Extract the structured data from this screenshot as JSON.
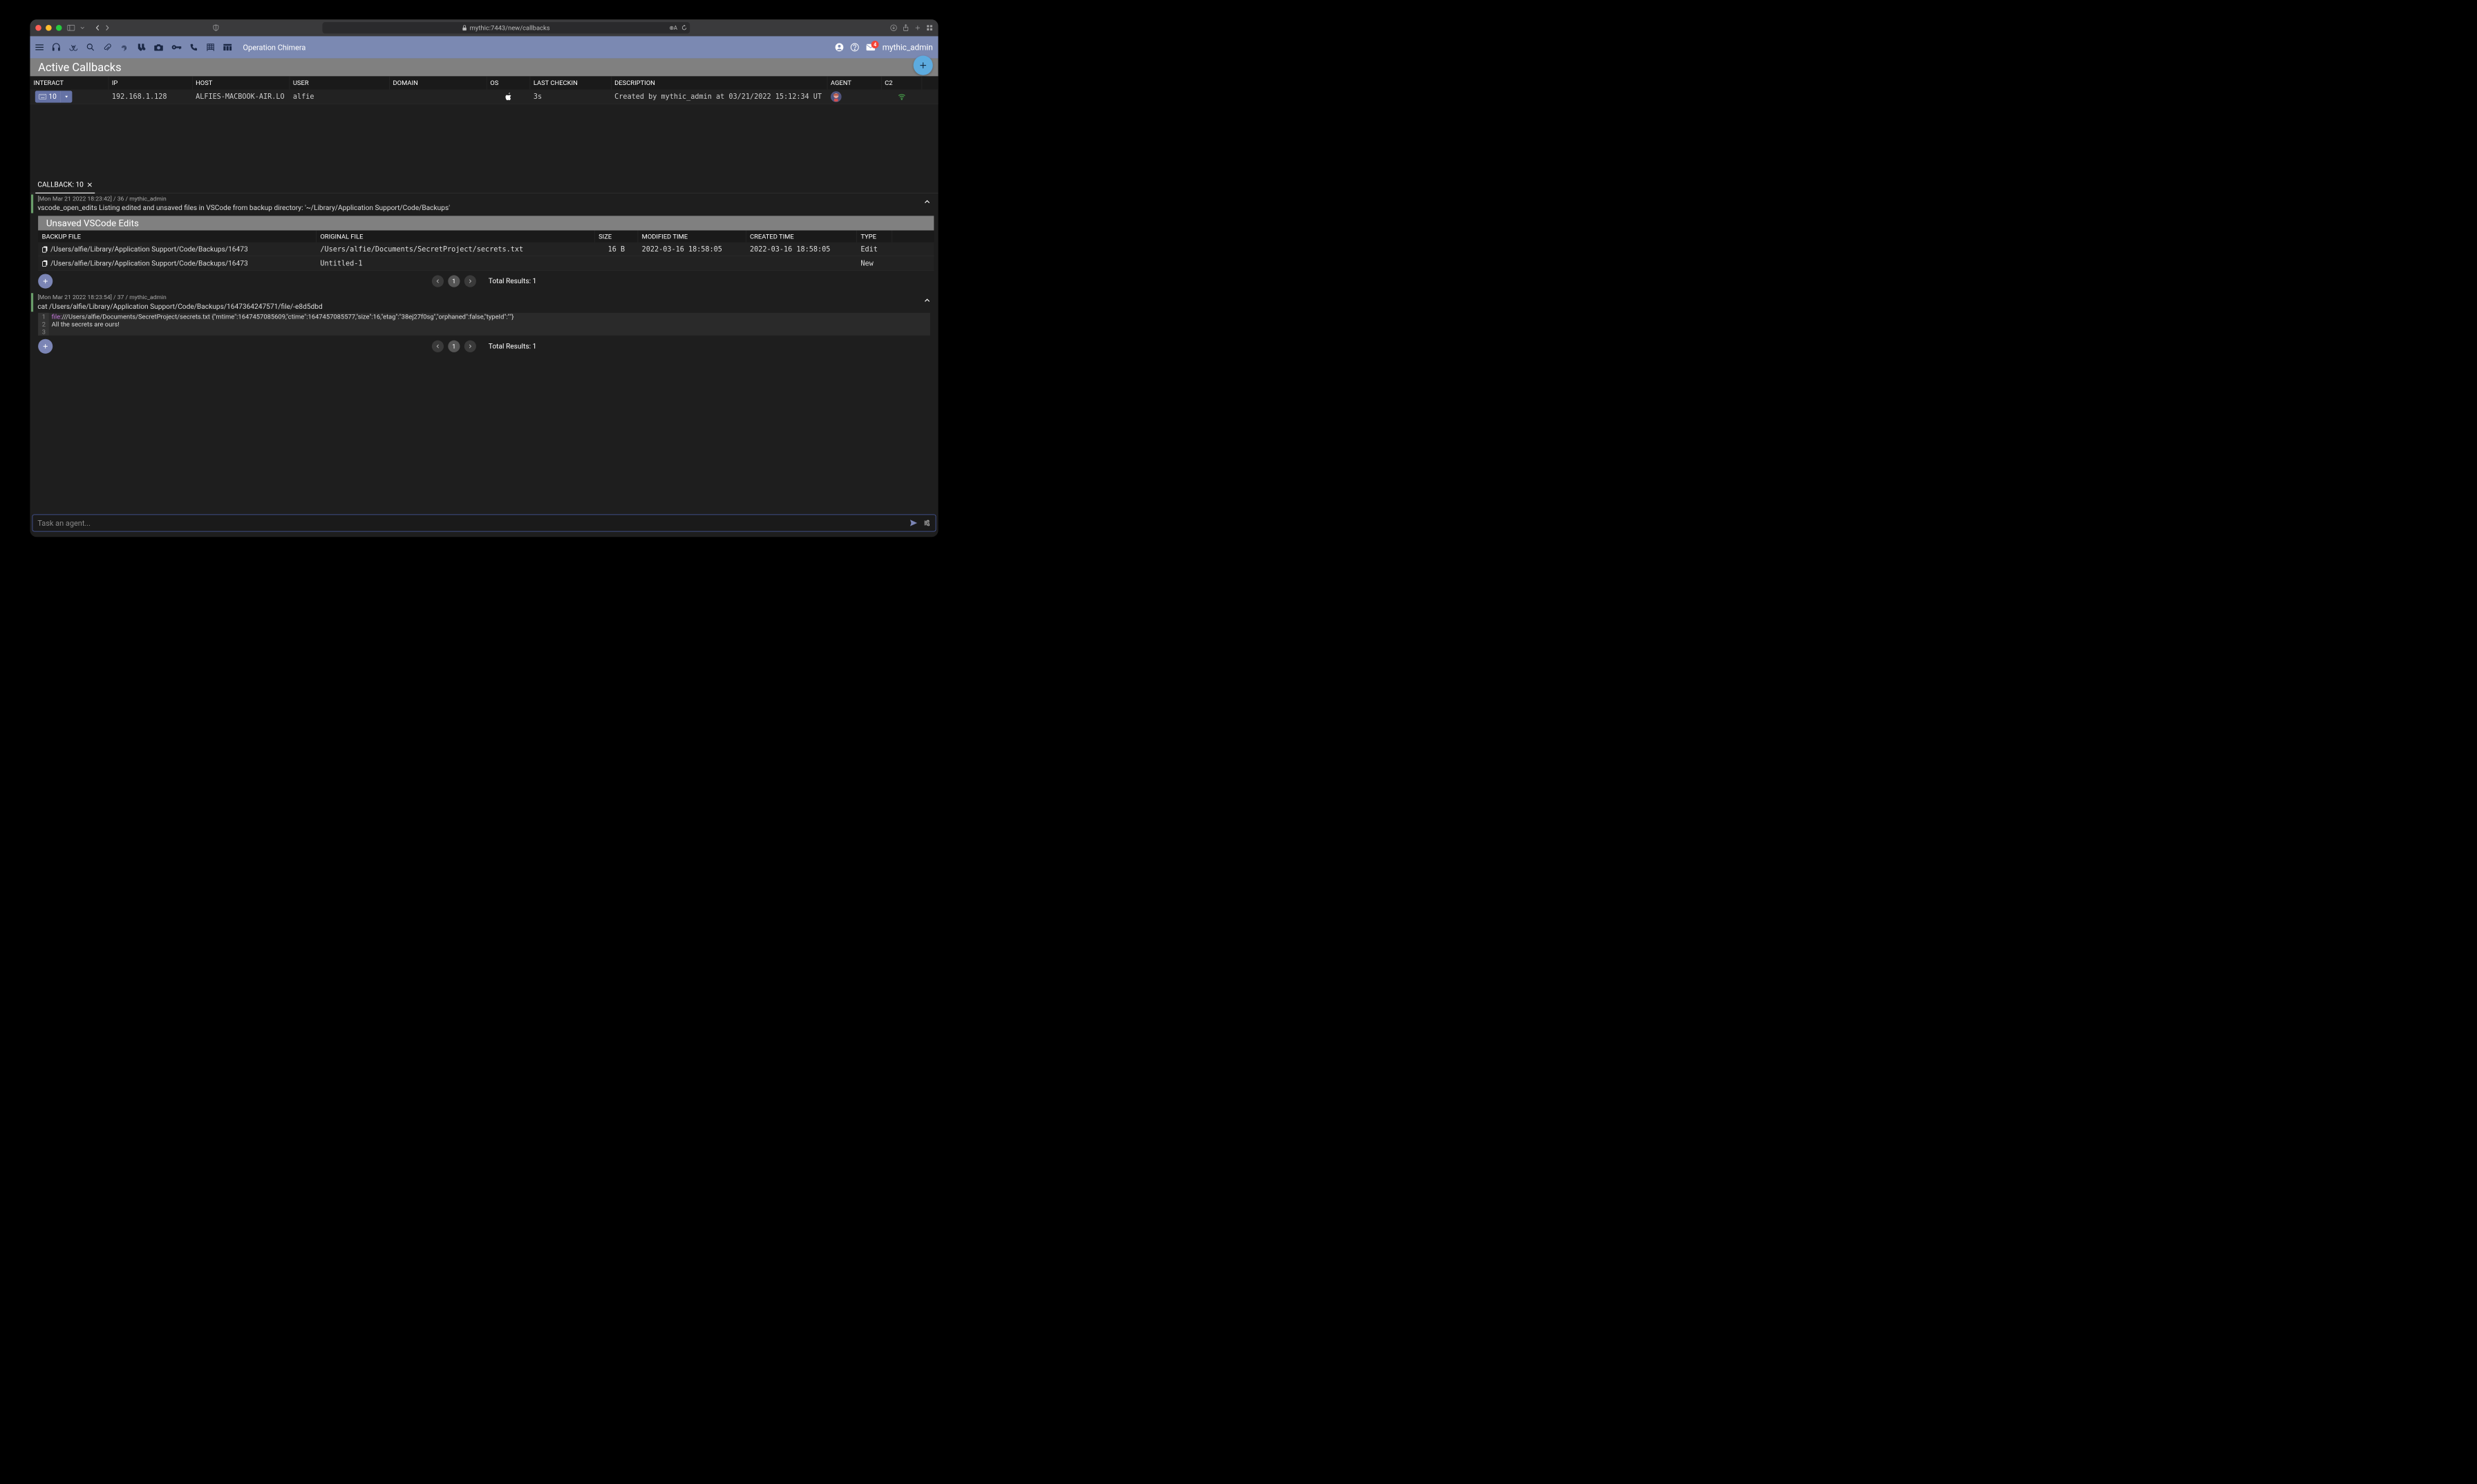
{
  "browser": {
    "url": "mythic:7443/new/callbacks"
  },
  "appbar": {
    "operation": "Operation Chimera",
    "notif_count": "4",
    "username": "mythic_admin"
  },
  "page": {
    "title": "Active Callbacks"
  },
  "callbacks": {
    "headers": {
      "interact": "INTERACT",
      "ip": "IP",
      "host": "HOST",
      "user": "USER",
      "domain": "DOMAIN",
      "os": "OS",
      "checkin": "LAST CHECKIN",
      "desc": "DESCRIPTION",
      "agent": "AGENT",
      "c2": "C2"
    },
    "rows": [
      {
        "id": "10",
        "ip": "192.168.1.128",
        "host": "ALFIES-MACBOOK-AIR.LO",
        "user": "alfie",
        "domain": "",
        "os": "apple",
        "checkin": "3s",
        "desc": "Created by mythic_admin at 03/21/2022 15:12:34 UT"
      }
    ]
  },
  "tab": {
    "label": "CALLBACK: 10"
  },
  "tasks": [
    {
      "meta": "[Mon Mar 21 2022 18:23:42] / 36 / mythic_admin",
      "cmd": "vscode_open_edits Listing edited and unsaved files in VSCode from backup directory: '~/Library/Application Support/Code/Backups'"
    },
    {
      "meta": "[Mon Mar 21 2022 18:23:54] / 37 / mythic_admin",
      "cmd": "cat /Users/alfie/Library/Application Support/Code/Backups/1647364247571/file/-e8d5dbd"
    }
  ],
  "vscode_panel": {
    "title": "Unsaved VSCode Edits",
    "headers": {
      "bf": "BACKUP FILE",
      "of": "ORIGINAL FILE",
      "sz": "SIZE",
      "mt": "MODIFIED TIME",
      "ct": "CREATED TIME",
      "tp": "TYPE"
    },
    "rows": [
      {
        "bf": "/Users/alfie/Library/Application Support/Code/Backups/16473",
        "of": "/Users/alfie/Documents/SecretProject/secrets.txt",
        "sz": "16 B",
        "mt": "2022-03-16 18:58:05",
        "ct": "2022-03-16 18:58:05",
        "tp": "Edit"
      },
      {
        "bf": "/Users/alfie/Library/Application Support/Code/Backups/16473",
        "of": "Untitled-1",
        "sz": "",
        "mt": "",
        "ct": "",
        "tp": "New"
      }
    ]
  },
  "pager": {
    "page": "1",
    "total": "Total Results: 1"
  },
  "cat_output": {
    "line1_prefix": "file:",
    "line1_rest": "///Users/alfie/Documents/SecretProject/secrets.txt {\"mtime\":1647457085609,\"ctime\":1647457085577,\"size\":16,\"etag\":\"38ej27f0sg\",\"orphaned\":false,\"typeId\":\"\"}",
    "line2": "All the secrets are ours!",
    "ln1": "1",
    "ln2": "2",
    "ln3": "3"
  },
  "cmdbar": {
    "placeholder": "Task an agent..."
  }
}
